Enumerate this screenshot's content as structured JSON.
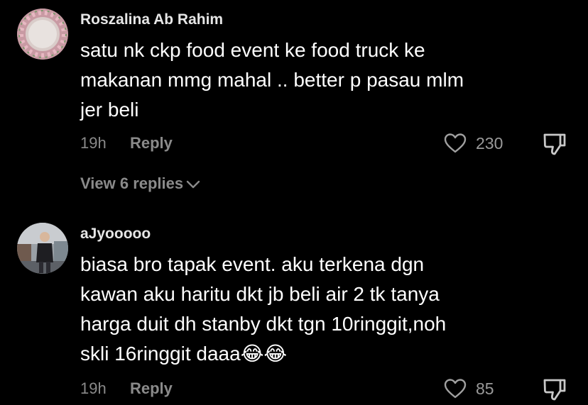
{
  "comments": [
    {
      "username": "Roszalina Ab Rahim",
      "lines": [
        "satu nk ckp food event ke food truck ke",
        "makanan mmg mahal .. better p pasau mlm",
        "jer beli"
      ],
      "time": "19h",
      "reply_label": "Reply",
      "like_count": "230",
      "view_replies_label": "View 6 replies",
      "avatar_icon": "floral-wreath-avatar"
    },
    {
      "username": "aJyooooo",
      "lines": [
        "biasa bro tapak event. aku terkena dgn",
        "kawan aku haritu dkt jb beli air 2 tk tanya",
        "harga duit dh stanby dkt tgn 10ringgit,noh",
        "skli 16ringgit daaa😂😂"
      ],
      "time": "19h",
      "reply_label": "Reply",
      "like_count": "85",
      "avatar_icon": "person-photo-avatar"
    }
  ],
  "colors": {
    "background": "#000000",
    "text": "#ffffff",
    "muted": "#8a8a8a"
  },
  "icons": [
    "heart-icon",
    "dislike-icon",
    "chevron-down-icon"
  ]
}
